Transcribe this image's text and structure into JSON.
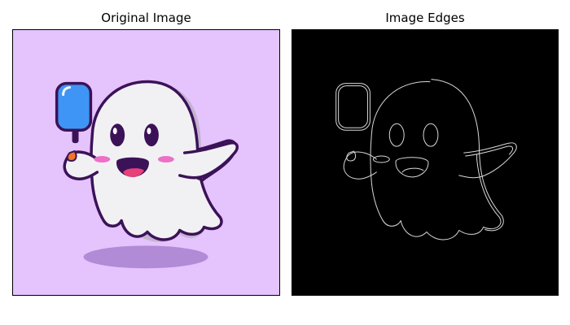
{
  "figure": {
    "left_panel": {
      "title": "Original Image",
      "background_color": "#e5c3fd"
    },
    "right_panel": {
      "title": "Image Edges",
      "background_color": "#000000"
    }
  },
  "colors": {
    "ghost_body": "#f1f1f3",
    "ghost_shadow": "#c3b3cf",
    "outline": "#3b1258",
    "popsicle": "#3e95f5",
    "cheeks": "#ee6fc7",
    "tongue": "#e8407a",
    "ground_shadow": "#b18bd6",
    "edge_lines": "#d9d9d9"
  }
}
